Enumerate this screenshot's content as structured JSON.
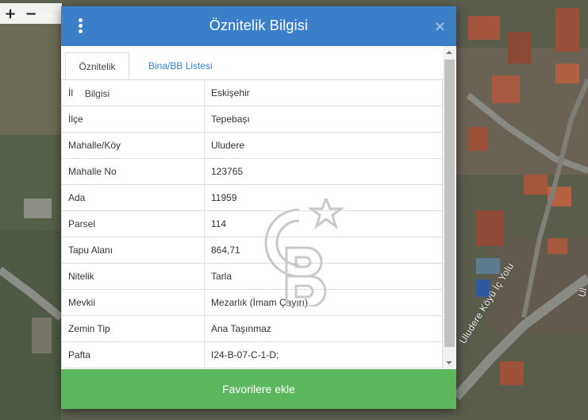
{
  "map": {
    "zoom_in": "+",
    "zoom_out": "−",
    "road_label": "Uludere Köyü İç Yolu",
    "road_label_2": "Ul"
  },
  "modal": {
    "title": "Öznitelik Bilgisi",
    "close_label": "×",
    "tabs": [
      {
        "label": "Öznitelik Bilgisi",
        "active": true
      },
      {
        "label": "Bina/BB Listesi",
        "active": false
      }
    ],
    "rows": [
      {
        "key": "İl",
        "value": "Eskişehir"
      },
      {
        "key": "İlçe",
        "value": "Tepebaşı"
      },
      {
        "key": "Mahalle/Köy",
        "value": "Uludere"
      },
      {
        "key": "Mahalle No",
        "value": "123765"
      },
      {
        "key": "Ada",
        "value": "11959"
      },
      {
        "key": "Parsel",
        "value": "114"
      },
      {
        "key": "Tapu Alanı",
        "value": "864,71"
      },
      {
        "key": "Nitelik",
        "value": "Tarla"
      },
      {
        "key": "Mevkii",
        "value": "Mezarlık (İmam Çayırı)"
      },
      {
        "key": "Zemin Tip",
        "value": "Ana Taşınmaz"
      },
      {
        "key": "Pafta",
        "value": "I24-B-07-C-1-D;"
      }
    ],
    "favorite_button": "Favorilere ekle"
  },
  "colors": {
    "header": "#3a7fc8",
    "button": "#5cb85c"
  }
}
